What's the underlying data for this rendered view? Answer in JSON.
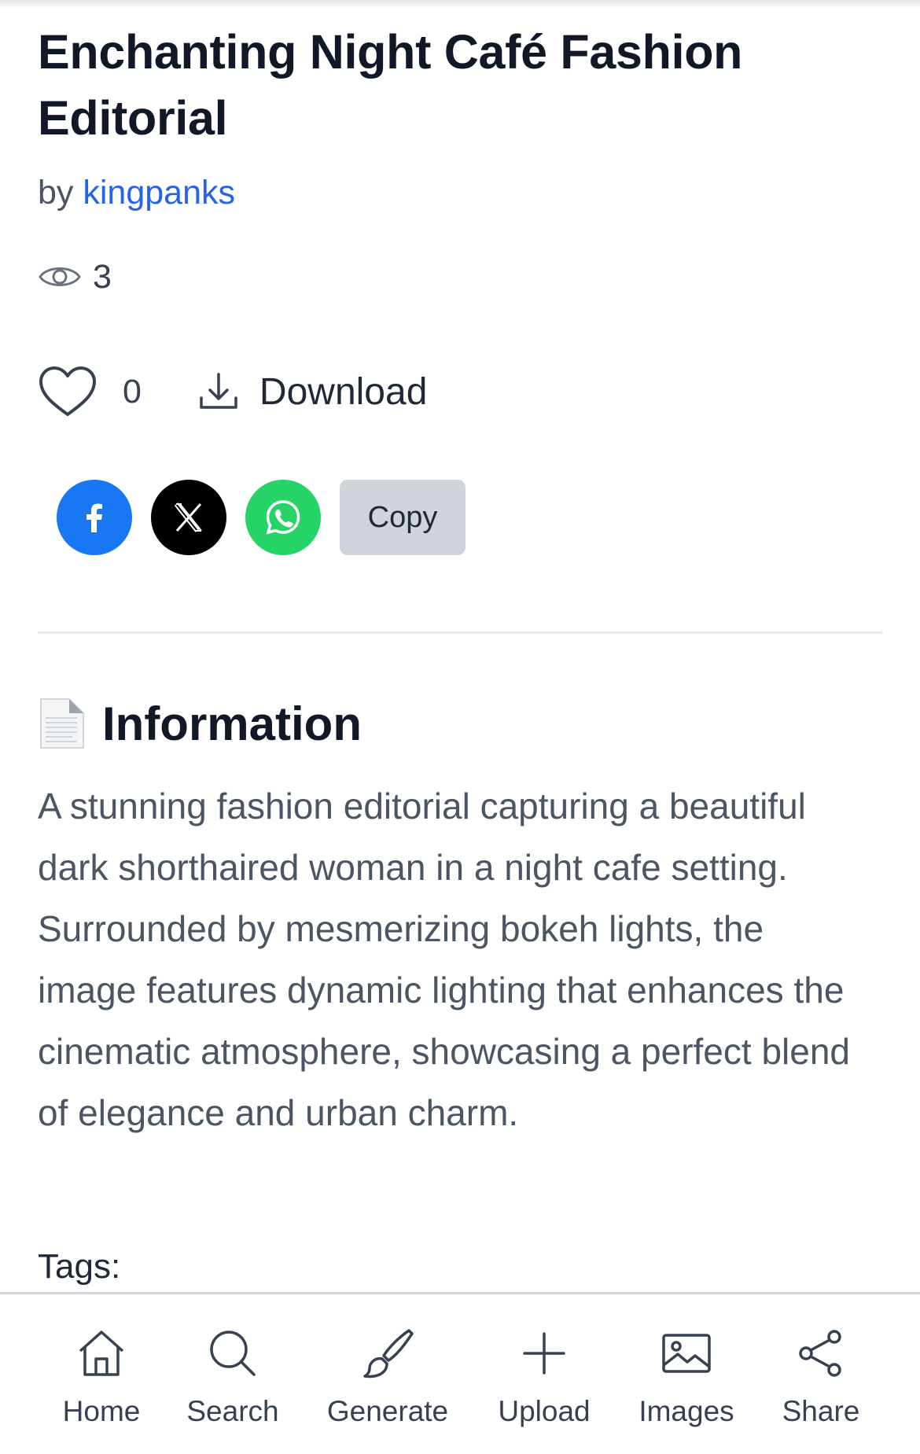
{
  "post": {
    "title": "Enchanting Night Café Fashion Editorial",
    "by_label": "by",
    "author": "kingpanks",
    "views": "3",
    "likes": "0",
    "download_label": "Download"
  },
  "share": {
    "copy_label": "Copy",
    "facebook_color": "#1877f2",
    "x_color": "#000000",
    "whatsapp_color": "#25d366"
  },
  "information": {
    "heading": "Information",
    "description": "A stunning fashion editorial capturing a beautiful dark shorthaired woman in a night cafe setting. Surrounded by mesmerizing bokeh lights, the image features dynamic lighting that enhances the cinematic atmosphere, showcasing a perfect blend of elegance and urban charm.",
    "tags_label": "Tags:"
  },
  "nav": {
    "items": [
      {
        "label": "Home",
        "icon": "home-icon"
      },
      {
        "label": "Search",
        "icon": "search-icon"
      },
      {
        "label": "Generate",
        "icon": "brush-icon"
      },
      {
        "label": "Upload",
        "icon": "plus-icon"
      },
      {
        "label": "Images",
        "icon": "image-icon"
      },
      {
        "label": "Share",
        "icon": "share-icon"
      }
    ]
  }
}
